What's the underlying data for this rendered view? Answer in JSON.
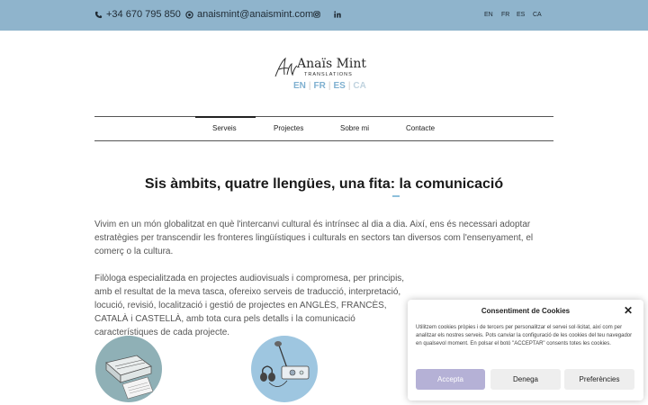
{
  "topbar": {
    "phone": "+34 670 795 850",
    "email": "anaismint@anaismint.com",
    "languages": [
      "EN",
      "FR",
      "ES",
      "CA"
    ],
    "icons": [
      "phone-icon",
      "at-icon",
      "instagram-icon",
      "linkedin-icon"
    ]
  },
  "logo": {
    "name": "Anaïs Mint",
    "subtitle": "TRANSLATIONS",
    "langs": [
      "EN",
      "FR",
      "ES",
      "CA"
    ]
  },
  "nav": {
    "items": [
      "Serveis",
      "Projectes",
      "Sobre mi",
      "Contacte"
    ],
    "active": "Serveis"
  },
  "main": {
    "heading": "Sis àmbits, quatre llengües, una fita: la comunicació",
    "paragraph1": "Vivim en un món globalitzat en què l'intercanvi cultural és intrínsec al dia a dia. Així, ens és necessari adoptar estratègies per transcendir les fronteres lingüístiques i culturals en sectors tan diversos com l'ensenyament, el comerç o la cultura.",
    "paragraph2": "Filòloga especialitzada en projectes audiovisuals i compromesa, per principis, amb el resultat de la meva tasca, ofereixo serveis de traducció, interpretació, locució, revisió, localització i gestió de projectes en ANGLÈS, FRANCÈS, CATALÀ i CASTELLÀ, amb tota cura pels detalls i la comunicació característiques de cada projecte."
  },
  "cookie": {
    "title": "Consentiment de Cookies",
    "text": "Utilitzem cookies pròpies i de tercers per personalitzar el servei sol·licitat, així com per analitzar els nostres serveis. Pots canviar la configuració de les cookies del teu navegador en qualsevol moment. En polsar el botó \"ACCEPTAR\" consents totes les cookies.",
    "accept": "Accepta",
    "deny": "Denega",
    "preferences": "Preferències"
  },
  "colors": {
    "topbar": "#8fb4cc",
    "accent": "#7fb0d0",
    "accept_button": "#b5b1d6"
  }
}
